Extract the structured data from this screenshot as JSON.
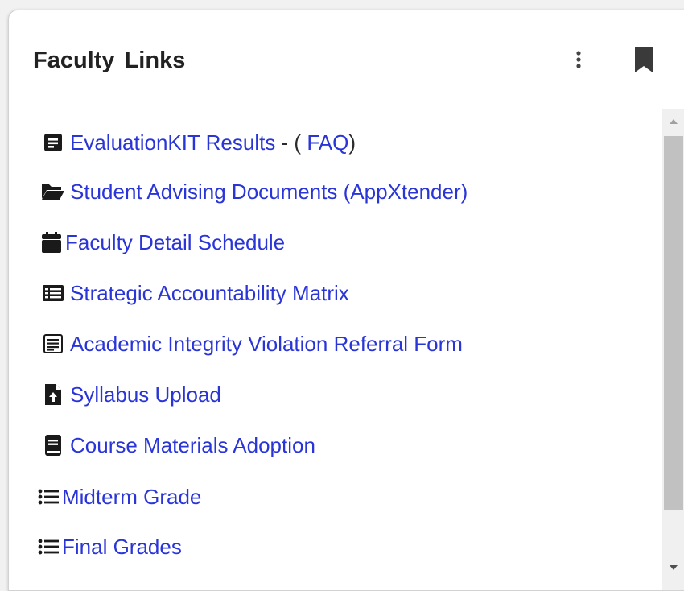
{
  "widget": {
    "title": "Faculty Links",
    "menu_icon": "more-vert-icon",
    "bookmark_icon": "bookmark-icon"
  },
  "links": [
    {
      "icon": "file-text-icon",
      "label": "EvaluationKIT Results",
      "sep": " - ( ",
      "extra_label": "FAQ",
      "suffix": ")"
    },
    {
      "icon": "folder-open-icon",
      "label": "Student Advising Documents (AppXtender)"
    },
    {
      "icon": "calendar-icon",
      "label": "Faculty Detail Schedule"
    },
    {
      "icon": "list-alt-icon",
      "label": "Strategic Accountability Matrix"
    },
    {
      "icon": "form-icon",
      "label": "Academic Integrity Violation Referral Form"
    },
    {
      "icon": "file-upload-icon",
      "label": "Syllabus Upload"
    },
    {
      "icon": "book-icon",
      "label": "Course Materials Adoption"
    },
    {
      "icon": "list-icon",
      "label": "Midterm Grade"
    },
    {
      "icon": "list-icon",
      "label": "Final Grades"
    }
  ],
  "colors": {
    "link": "#2a35d8",
    "title": "#222222",
    "icon": "#1a1a1a"
  }
}
